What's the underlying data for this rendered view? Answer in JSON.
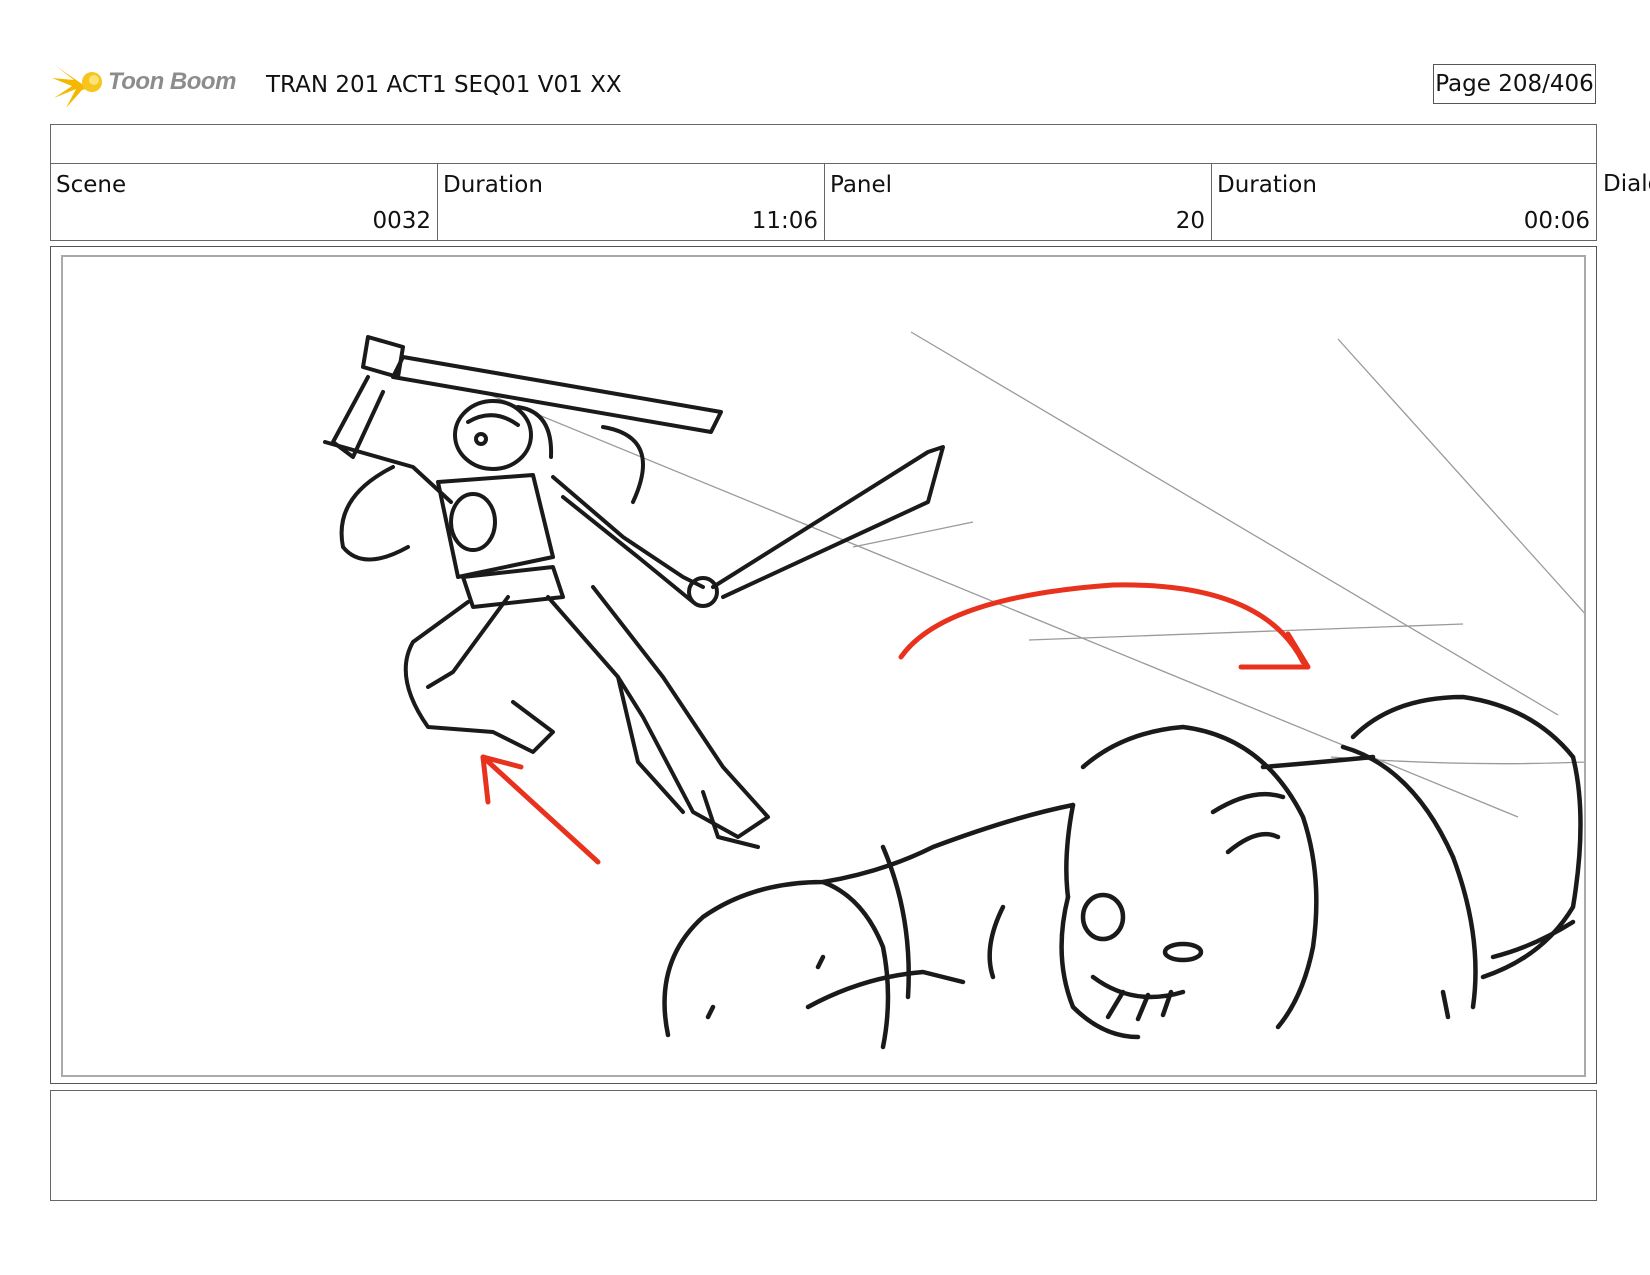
{
  "header": {
    "logo_text": "Toon Boom",
    "title": "TRAN 201 ACT1 SEQ01 V01 XX",
    "page": "Page 208/406"
  },
  "info": {
    "scene_label": "Scene",
    "scene_value": "0032",
    "scene_duration_label": "Duration",
    "scene_duration_value": "11:06",
    "panel_label": "Panel",
    "panel_value": "20",
    "panel_duration_label": "Duration",
    "panel_duration_value": "00:06",
    "dialog_label": "Dialo"
  },
  "colors": {
    "logo_yellow": "#f5b800",
    "arrow_red": "#e8321e",
    "ink": "#1a1a1a"
  },
  "icons": [
    "toon-boom-logo-icon"
  ]
}
